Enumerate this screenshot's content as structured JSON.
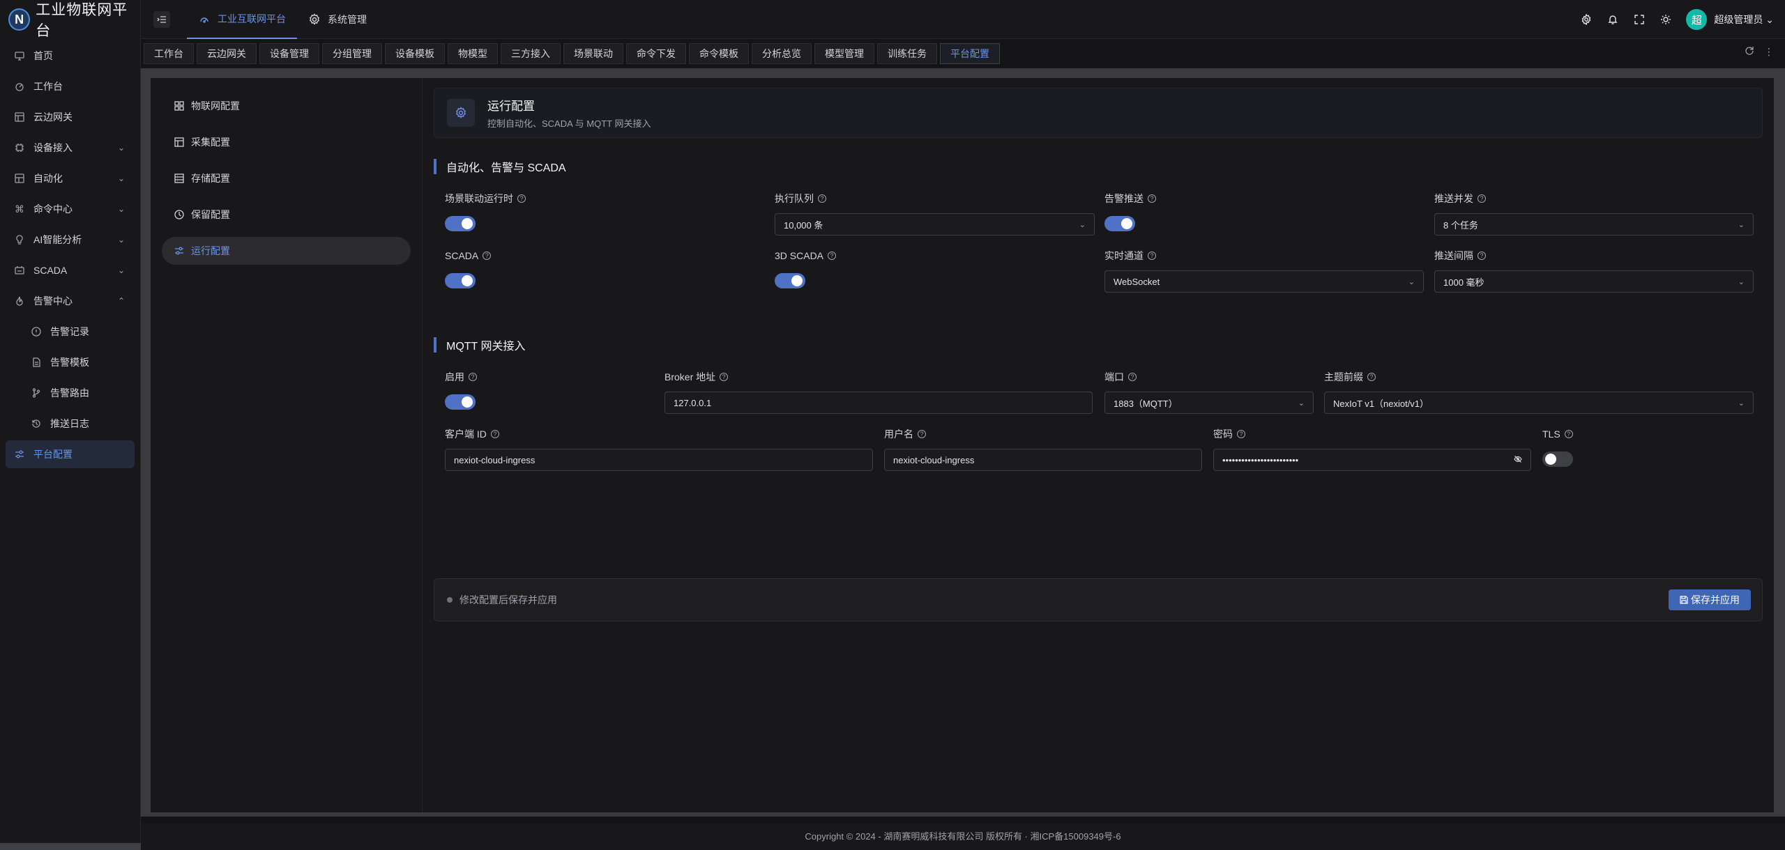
{
  "app": {
    "logo_letter": "N",
    "title": "工业物联网平台"
  },
  "sidebar": {
    "items": [
      {
        "label": "首页",
        "icon": "monitor-icon"
      },
      {
        "label": "工作台",
        "icon": "dashboard-icon"
      },
      {
        "label": "云边网关",
        "icon": "gateway-icon"
      },
      {
        "label": "设备接入",
        "icon": "device-icon",
        "expandable": true
      },
      {
        "label": "自动化",
        "icon": "automation-icon",
        "expandable": true
      },
      {
        "label": "命令中心",
        "icon": "command-icon",
        "expandable": true
      },
      {
        "label": "AI智能分析",
        "icon": "ai-icon",
        "expandable": true
      },
      {
        "label": "SCADA",
        "icon": "scada-icon",
        "expandable": true
      },
      {
        "label": "告警中心",
        "icon": "alarm-icon",
        "expanded": true
      },
      {
        "label": "告警记录",
        "icon": "alert-circle-icon",
        "sub": true
      },
      {
        "label": "告警模板",
        "icon": "template-icon",
        "sub": true
      },
      {
        "label": "告警路由",
        "icon": "route-icon",
        "sub": true
      },
      {
        "label": "推送日志",
        "icon": "history-icon",
        "sub": true
      },
      {
        "label": "平台配置",
        "icon": "sliders-icon",
        "active": true
      }
    ]
  },
  "header": {
    "tabs": [
      {
        "label": "工业互联网平台",
        "active": true
      },
      {
        "label": "系统管理",
        "active": false
      }
    ],
    "user": {
      "avatar": "超",
      "name": "超级管理员"
    }
  },
  "page_tabs": [
    "工作台",
    "云边网关",
    "设备管理",
    "分组管理",
    "设备模板",
    "物模型",
    "三方接入",
    "场景联动",
    "命令下发",
    "命令模板",
    "分析总览",
    "模型管理",
    "训练任务",
    "平台配置"
  ],
  "active_page_tab": "平台配置",
  "submenu": [
    {
      "label": "物联网配置",
      "icon": "grid-icon"
    },
    {
      "label": "采集配置",
      "icon": "layout-icon"
    },
    {
      "label": "存储配置",
      "icon": "storage-icon"
    },
    {
      "label": "保留配置",
      "icon": "clock-icon"
    },
    {
      "label": "运行配置",
      "icon": "sliders-icon",
      "active": true
    }
  ],
  "page_header": {
    "title": "运行配置",
    "subtitle": "控制自动化、SCADA 与 MQTT 网关接入"
  },
  "section1": {
    "title": "自动化、告警与 SCADA",
    "scene_runtime": {
      "label": "场景联动运行时",
      "on": true
    },
    "exec_queue": {
      "label": "执行队列",
      "value": "10,000 条"
    },
    "alarm_push": {
      "label": "告警推送",
      "on": true
    },
    "push_concurrency": {
      "label": "推送并发",
      "value": "8 个任务"
    },
    "scada": {
      "label": "SCADA",
      "on": true
    },
    "scada3d": {
      "label": "3D SCADA",
      "on": true
    },
    "realtime_channel": {
      "label": "实时通道",
      "value": "WebSocket"
    },
    "push_interval": {
      "label": "推送间隔",
      "value": "1000 毫秒"
    }
  },
  "section2": {
    "title": "MQTT 网关接入",
    "enable": {
      "label": "启用",
      "on": true
    },
    "broker": {
      "label": "Broker 地址",
      "value": "127.0.0.1"
    },
    "port": {
      "label": "端口",
      "value": "1883（MQTT）"
    },
    "topic_prefix": {
      "label": "主题前缀",
      "value": "NexIoT v1（nexiot/v1）"
    },
    "client_id": {
      "label": "客户端 ID",
      "value": "nexiot-cloud-ingress"
    },
    "username": {
      "label": "用户名",
      "value": "nexiot-cloud-ingress"
    },
    "password": {
      "label": "密码",
      "value": "••••••••••••••••••••••••"
    },
    "tls": {
      "label": "TLS",
      "on": false
    }
  },
  "footer": {
    "hint": "修改配置后保存并应用",
    "save_label": "保存并应用"
  },
  "copyright": "Copyright © 2024 - 湖南赛明威科技有限公司 版权所有 · 湘ICP备15009349号-6",
  "colors": {
    "accent": "#4f72c7",
    "active_text": "#6b93e6",
    "avatar": "#14b8a6"
  }
}
